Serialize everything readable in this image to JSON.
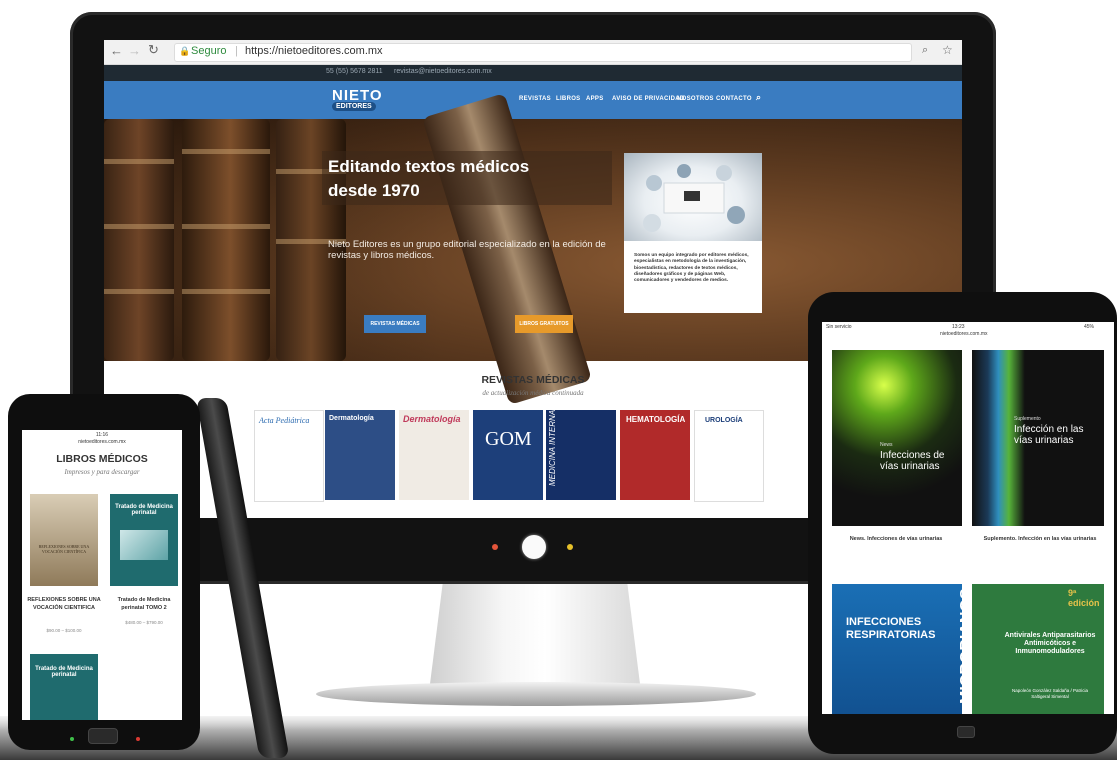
{
  "monitor": {
    "browser": {
      "secure_label": "Seguro",
      "url": "https://nietoeditores.com.mx",
      "back_icon": "arrow-left-icon",
      "forward_icon": "arrow-right-icon",
      "reload_icon": "reload-icon",
      "lock_icon": "lock-icon",
      "zoom_icon": "zoom-icon",
      "star_icon": "star-icon"
    },
    "topbar": {
      "phone": "55 (55) 5678 2811",
      "email": "revistas@nietoeditores.com.mx"
    },
    "logo": {
      "line1": "NIETO",
      "line2": "EDITORES"
    },
    "nav": [
      "REVISTAS",
      "LIBROS",
      "APPS",
      "AVISO DE PRIVACIDAD",
      "NOSOTROS",
      "CONTACTO"
    ],
    "hero": {
      "title_line1": "Editando textos médicos",
      "title_line2": "desde 1970",
      "description": "Nieto Editores es un grupo editorial especializado en la edición de revistas y libros médicos.",
      "btn_revistas": "REVISTAS MÉDICAS",
      "btn_libros": "LIBROS GRATUITOS",
      "card_text": "Somos un equipo integrado por editores médicos, especialistas en metodología de la investigación, bioestadística, redactores de textos médicos, diseñadores gráficos y de páginas Web, comunicadores y vendedores de medios."
    },
    "section": {
      "title": "REVISTAS MÉDICAS",
      "subtitle": "de actualización médica continuada"
    },
    "covers": [
      {
        "title": "Acta Pediátrica",
        "color": "#ffffff"
      },
      {
        "title": "Dermatología",
        "color": "#2d4e86"
      },
      {
        "title": "Dermatología",
        "color": "#f0ebe4"
      },
      {
        "title": "GOM",
        "color": "#1d3f7a"
      },
      {
        "title": "MEDICINA INTERNA",
        "color": "#152f66"
      },
      {
        "title": "HEMATOLOGÍA",
        "color": "#b12a2a"
      },
      {
        "title": "UROLOGÍA",
        "color": "#ffffff"
      }
    ]
  },
  "phone": {
    "status_time": "11:16",
    "status_url": "nietoeditores.com.mx",
    "title": "LIBROS MÉDICOS",
    "subtitle": "Impresos y para descargar",
    "books": [
      {
        "cover_text": "REFLEXIONES SOBRE UNA VOCACIÓN CIENTÍFICA",
        "caption": "REFLEXIONES SOBRE UNA VOCACIÓN CIENTIFICA",
        "price": "$90.00 – $100.00"
      },
      {
        "cover_text": "Tratado de Medicina perinatal",
        "caption": "Tratado de Medicina perinatal TOMO 2",
        "price": "$480.00 – $790.00"
      },
      {
        "cover_text": "Tratado de Medicina perinatal"
      }
    ]
  },
  "tablet": {
    "status_left": "Sin servicio",
    "status_time": "13:23",
    "status_battery": "45%",
    "status_url": "nietoeditores.com.mx",
    "books": [
      {
        "cover_small": "News",
        "cover_title": "Infecciones de vías urinarias",
        "caption": "News. Infecciones de vías urinarias"
      },
      {
        "cover_small": "Suplemento",
        "cover_title": "Infección en las vías urinarias",
        "caption": "Suplemento. Infección en las vías urinarias"
      },
      {
        "cover_title": "INFECCIONES RESPIRATORIAS"
      },
      {
        "cover_side": "MICROBIANOS",
        "cover_edition": "9ª edición",
        "cover_title": "Antivirales Antiparasitarios Antimicóticos e Inmunomoduladores",
        "cover_authors": "Napoleón González Saldaña / Patricia Saltigeral Simental"
      }
    ]
  }
}
